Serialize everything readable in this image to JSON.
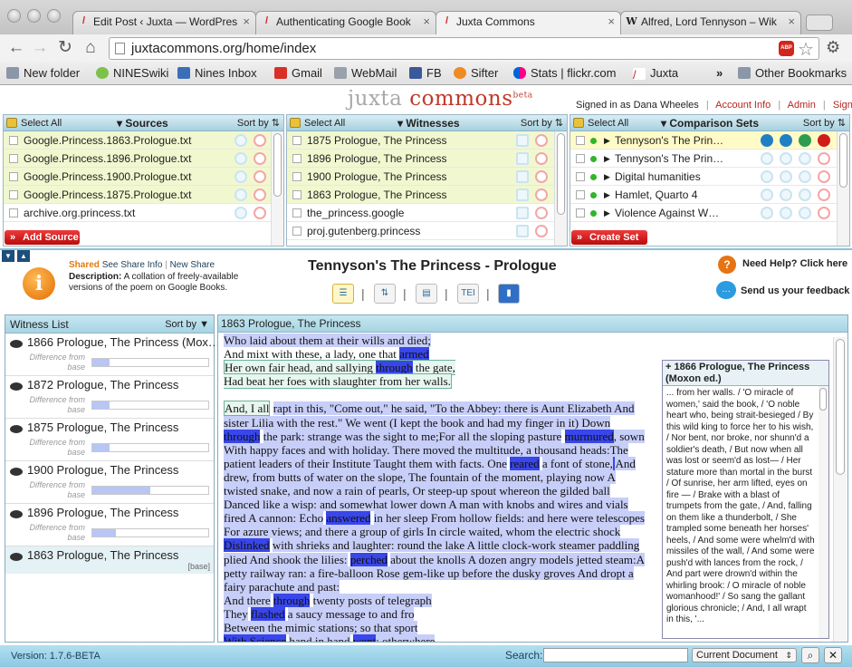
{
  "browser": {
    "tabs": [
      {
        "title": "Edit Post ‹ Juxta — WordPres",
        "icon": "juxta-favicon"
      },
      {
        "title": "Authenticating Google Book",
        "icon": "juxta-favicon"
      },
      {
        "title": "Juxta Commons",
        "icon": "juxta-favicon",
        "active": true
      },
      {
        "title": "Alfred, Lord Tennyson – Wik",
        "icon": "wikipedia-favicon",
        "fav_letter": "W"
      }
    ],
    "url": "juxtacommons.org/home/index",
    "abp_label": "ABP",
    "bookmarks": [
      {
        "label": "New folder",
        "icon": "folder-icon"
      },
      {
        "label": "NINESwiki",
        "icon": "wiki-icon"
      },
      {
        "label": "Nines Inbox",
        "icon": "inbox-icon"
      },
      {
        "label": "Gmail",
        "icon": "gmail-icon"
      },
      {
        "label": "WebMail",
        "icon": "webmail-icon"
      },
      {
        "label": "FB",
        "icon": "facebook-icon"
      },
      {
        "label": "Sifter",
        "icon": "sifter-icon"
      },
      {
        "label": "Stats | flickr.com",
        "icon": "flickr-icon"
      },
      {
        "label": "Juxta",
        "icon": "juxta-icon"
      },
      {
        "label": "Other Bookmarks",
        "icon": "folder-icon"
      }
    ],
    "more_label": "»"
  },
  "header": {
    "logo_text_1": "juxta",
    "logo_text_2": "commons",
    "logo_beta": "beta",
    "signed_in": "Signed in as Dana Wheeles",
    "account_info": "Account Info",
    "admin": "Admin",
    "sign_out": "Sign Out",
    "sep": "|"
  },
  "sources": {
    "select_all": "Select All",
    "title": "Sources",
    "sort_by": "Sort by",
    "items": [
      "Google.Princess.1863.Prologue.txt",
      "Google.Princess.1896.Prologue.txt",
      "Google.Princess.1900.Prologue.txt",
      "Google.Princess.1875.Prologue.txt",
      "archive.org.princess.txt"
    ],
    "add_button": "Add Source"
  },
  "witnesses": {
    "select_all": "Select All",
    "title": "Witnesses",
    "sort_by": "Sort by",
    "items": [
      "1875 Prologue, The Princess",
      "1896 Prologue, The Princess",
      "1900 Prologue, The Princess",
      "1863 Prologue, The Princess",
      "the_princess.google",
      "proj.gutenberg.princess"
    ]
  },
  "comparison_sets": {
    "select_all": "Select All",
    "title": "Comparison Sets",
    "sort_by": "Sort by",
    "items": [
      "Tennyson's The Prin…",
      "Tennyson's The Prin…",
      "Digital humanities",
      "Hamlet, Quarto 4",
      "Violence Against W…"
    ],
    "create_button": "Create Set"
  },
  "info": {
    "shared": "Shared",
    "see_share_info": "See Share Info",
    "new_share": "New Share",
    "description_label": "Description:",
    "description": "A collation of freely-available versions of the poem on Google Books.",
    "set_title": "Tennyson's The Princess - Prologue",
    "help": "Need Help? Click here",
    "feedback": "Send us your feedback",
    "view_tei": "TEI"
  },
  "witness_list": {
    "title": "Witness List",
    "sort_by": "Sort by",
    "diff_label": "Difference from base",
    "base_tag": "[base]",
    "items": [
      {
        "name": "1866 Prologue, The Princess (Mox…",
        "diff": 0.15
      },
      {
        "name": "1872 Prologue, The Princess",
        "diff": 0.15
      },
      {
        "name": "1875 Prologue, The Princess",
        "diff": 0.15
      },
      {
        "name": "1900 Prologue, The Princess",
        "diff": 0.5
      },
      {
        "name": "1896 Prologue, The Princess",
        "diff": 0.2
      },
      {
        "name": "1863 Prologue, The Princess",
        "base": true
      }
    ]
  },
  "text_panel": {
    "title": "1863 Prologue, The Princess",
    "side_title": "1866 Prologue, The Princess (Moxon ed.)",
    "side_plus": "+",
    "side_text": "... from her walls. / 'O miracle of women,' said the book, / 'O noble heart who, being strait-besieged / By this wild king to force her to his wish, / Nor bent, nor broke, nor shunn'd a soldier's death, / But now when all was lost or seem'd as lost— / Her stature more than mortal in the burst / Of sunrise, her arm lifted, eyes on fire — / Brake with a blast of trumpets from the gate, / And, falling on them like a thunderbolt, / She trampled some beneath her horses' heels, / And some were whelm'd with missiles of the wall, / And some were push'd with lances from the rock, / And part were drown'd within the whirling brook: / O miracle of noble womanhood!' / So sang the gallant glorious chronicle; / And, I all wrapt in this, '..."
  },
  "footer": {
    "version": "Version: 1.7.6-BETA",
    "search_label": "Search:",
    "scope": "Current Document"
  }
}
